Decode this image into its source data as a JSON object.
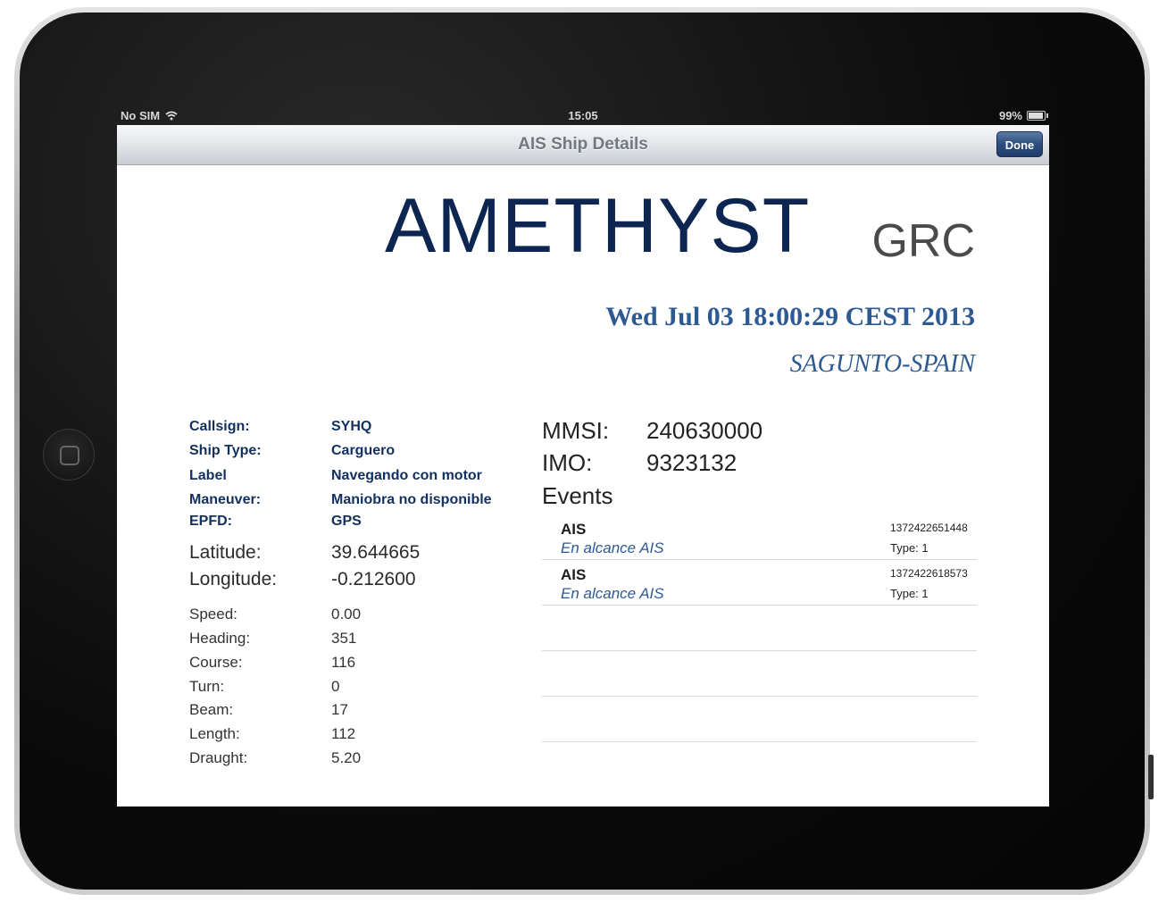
{
  "status": {
    "carrier": "No SIM",
    "time": "15:05",
    "battery": "99%"
  },
  "nav": {
    "title": "AIS Ship Details",
    "done_label": "Done"
  },
  "ship": {
    "name": "AMETHYST",
    "flag": "GRC",
    "datetime": "Wed Jul 03 18:00:29 CEST 2013",
    "port": "SAGUNTO-SPAIN"
  },
  "details": [
    {
      "label": "Callsign:",
      "value": "SYHQ"
    },
    {
      "label": "Ship Type:",
      "value": "Carguero"
    },
    {
      "label": "Label",
      "value": "Navegando con motor"
    },
    {
      "label": "Maneuver:",
      "value": "Maniobra no disponible"
    },
    {
      "label": "EPFD:",
      "value": "GPS"
    }
  ],
  "position": [
    {
      "label": "Latitude:",
      "value": "39.644665"
    },
    {
      "label": "Longitude:",
      "value": "-0.212600"
    }
  ],
  "motion": [
    {
      "label": "Speed:",
      "value": "0.00"
    },
    {
      "label": "Heading:",
      "value": "351"
    },
    {
      "label": "Course:",
      "value": "116"
    },
    {
      "label": "Turn:",
      "value": "0"
    },
    {
      "label": "Beam:",
      "value": "17"
    },
    {
      "label": "Length:",
      "value": "112"
    },
    {
      "label": "Draught:",
      "value": "5.20"
    }
  ],
  "ids": {
    "mmsi_label": "MMSI:",
    "mmsi": "240630000",
    "imo_label": "IMO:",
    "imo": "9323132"
  },
  "events": {
    "title": "Events",
    "items": [
      {
        "type": "AIS",
        "desc": "En alcance AIS",
        "id": "1372422651448",
        "sub": "Type: 1"
      },
      {
        "type": "AIS",
        "desc": "En alcance AIS",
        "id": "1372422618573",
        "sub": "Type: 1"
      }
    ]
  },
  "icons": {
    "wifi": "wifi-icon",
    "battery": "battery-icon",
    "home": "home-button-icon"
  }
}
